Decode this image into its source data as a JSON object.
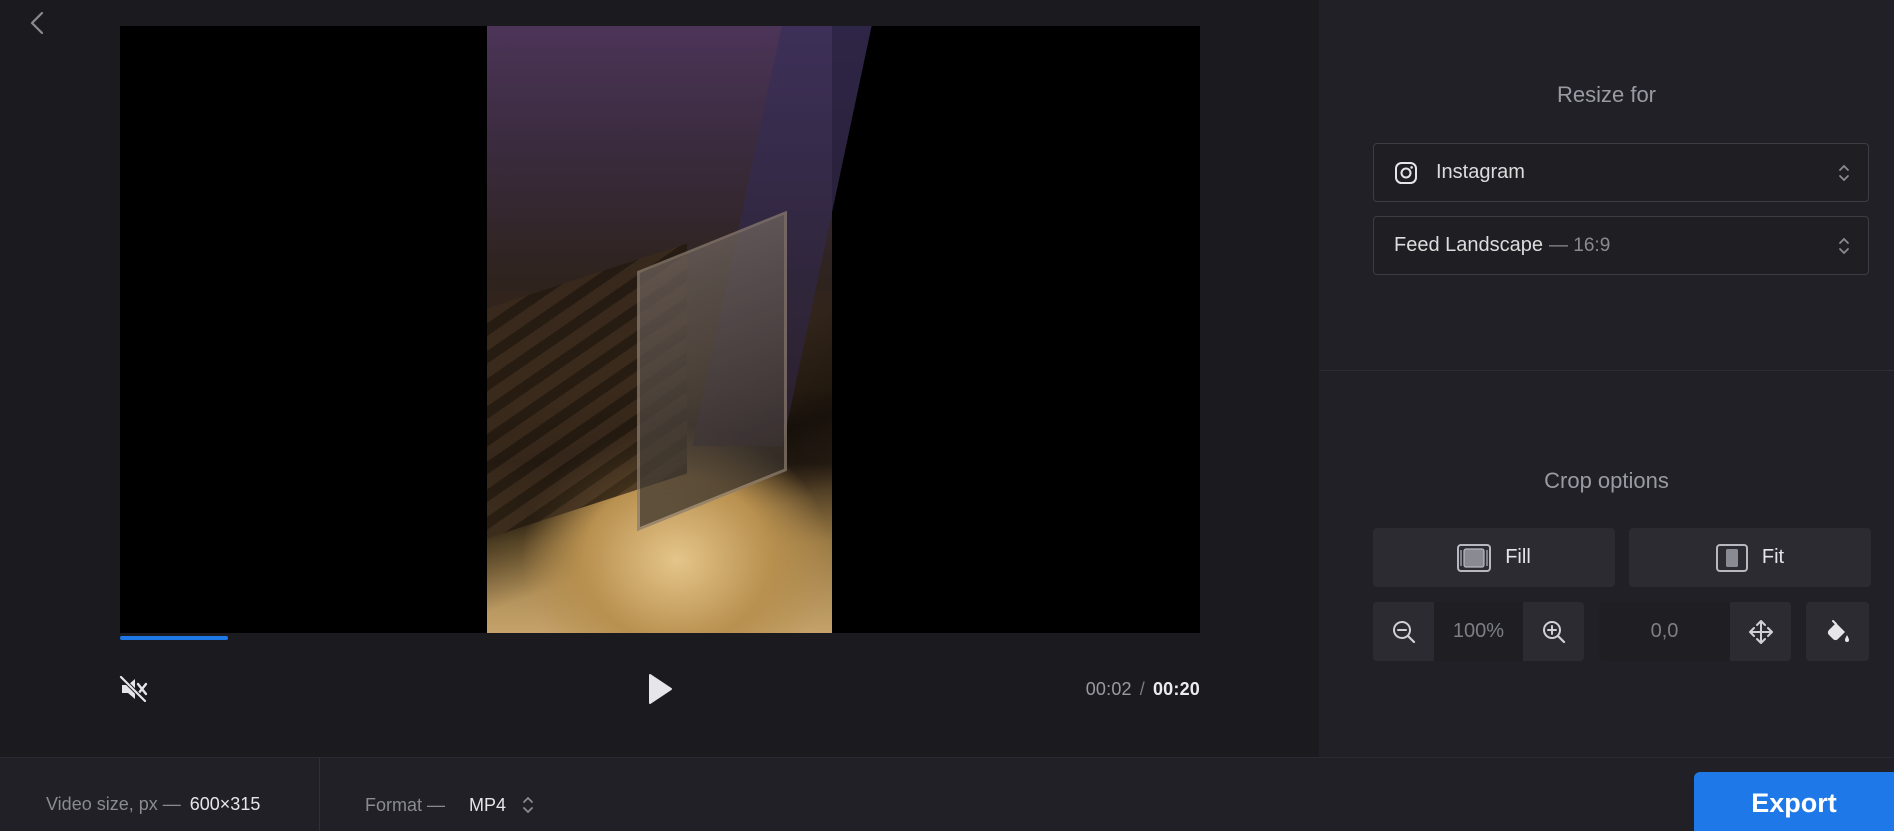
{
  "player": {
    "current_time": "00:02",
    "separator": "/",
    "total_time": "00:20",
    "progress_fraction": 0.1
  },
  "resize": {
    "title": "Resize for",
    "platform": "Instagram",
    "preset_label": "Feed Landscape",
    "preset_ratio": "— 16:9"
  },
  "crop": {
    "title": "Crop options",
    "fill_label": "Fill",
    "fit_label": "Fit",
    "zoom_value": "100%",
    "position_value": "0,0"
  },
  "bottom": {
    "video_size_label": "Video size, px —",
    "video_size_value": "600×315",
    "format_label": "Format —",
    "format_value": "MP4",
    "export_label": "Export"
  },
  "colors": {
    "accent": "#1f78e8",
    "panel_bg": "#202026",
    "editor_bg": "#1a1a1f"
  },
  "icons": [
    "chevron-left-icon",
    "mute-icon",
    "play-icon",
    "instagram-icon",
    "updown-arrows-icon",
    "fill-icon",
    "fit-icon",
    "zoom-out-icon",
    "zoom-in-icon",
    "move-icon",
    "paint-bucket-icon"
  ]
}
